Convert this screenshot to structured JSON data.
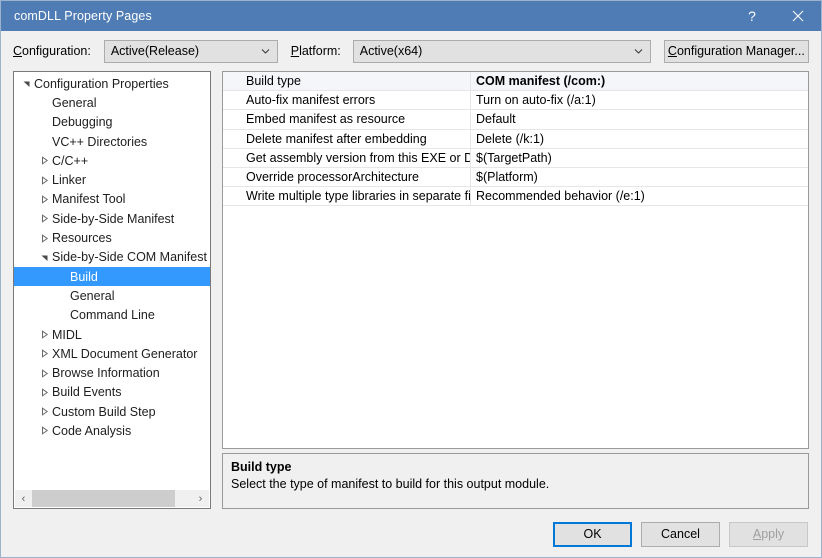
{
  "window": {
    "title": "comDLL Property Pages",
    "help_icon": "?",
    "close_icon": "close-icon",
    "titlebar_color": "#4f7cb5"
  },
  "config_bar": {
    "configuration_label": "Configuration:",
    "configuration_accel": "C",
    "configuration_value": "Active(Release)",
    "platform_label": "Platform:",
    "platform_accel": "P",
    "platform_value": "Active(x64)",
    "config_manager_label": "Configuration Manager...",
    "config_manager_accel": "C"
  },
  "tree": {
    "selected_color": "#3399ff",
    "nodes": [
      {
        "label": "Configuration Properties",
        "indent": 0,
        "expander": "expanded",
        "selected": false
      },
      {
        "label": "General",
        "indent": 1,
        "expander": "none",
        "selected": false
      },
      {
        "label": "Debugging",
        "indent": 1,
        "expander": "none",
        "selected": false
      },
      {
        "label": "VC++ Directories",
        "indent": 1,
        "expander": "none",
        "selected": false
      },
      {
        "label": "C/C++",
        "indent": 1,
        "expander": "collapsed",
        "selected": false
      },
      {
        "label": "Linker",
        "indent": 1,
        "expander": "collapsed",
        "selected": false
      },
      {
        "label": "Manifest Tool",
        "indent": 1,
        "expander": "collapsed",
        "selected": false
      },
      {
        "label": "Side-by-Side Manifest",
        "indent": 1,
        "expander": "collapsed",
        "selected": false
      },
      {
        "label": "Resources",
        "indent": 1,
        "expander": "collapsed",
        "selected": false
      },
      {
        "label": "Side-by-Side COM Manifest",
        "indent": 1,
        "expander": "expanded",
        "selected": false
      },
      {
        "label": "Build",
        "indent": 2,
        "expander": "none",
        "selected": true
      },
      {
        "label": "General",
        "indent": 2,
        "expander": "none",
        "selected": false
      },
      {
        "label": "Command Line",
        "indent": 2,
        "expander": "none",
        "selected": false
      },
      {
        "label": "MIDL",
        "indent": 1,
        "expander": "collapsed",
        "selected": false
      },
      {
        "label": "XML Document Generator",
        "indent": 1,
        "expander": "collapsed",
        "selected": false
      },
      {
        "label": "Browse Information",
        "indent": 1,
        "expander": "collapsed",
        "selected": false
      },
      {
        "label": "Build Events",
        "indent": 1,
        "expander": "collapsed",
        "selected": false
      },
      {
        "label": "Custom Build Step",
        "indent": 1,
        "expander": "collapsed",
        "selected": false
      },
      {
        "label": "Code Analysis",
        "indent": 1,
        "expander": "collapsed",
        "selected": false
      }
    ],
    "scrollbar": {
      "left_arrow": "‹",
      "right_arrow": "›"
    }
  },
  "property_grid": {
    "rows": [
      {
        "name": "Build type",
        "value": "COM manifest (/com:)"
      },
      {
        "name": "Auto-fix manifest errors",
        "value": "Turn on auto-fix (/a:1)"
      },
      {
        "name": "Embed manifest as resource",
        "value": "Default"
      },
      {
        "name": "Delete manifest after embedding",
        "value": "Delete (/k:1)"
      },
      {
        "name": "Get assembly version from this EXE or DLL",
        "value": "$(TargetPath)"
      },
      {
        "name": "Override processorArchitecture",
        "value": "$(Platform)"
      },
      {
        "name": "Write multiple type libraries in separate file",
        "value": "Recommended behavior (/e:1)"
      }
    ]
  },
  "description": {
    "title": "Build type",
    "text": "Select the type of manifest to build for this output module."
  },
  "footer": {
    "ok_label": "OK",
    "cancel_label": "Cancel",
    "apply_label": "Apply",
    "apply_accel": "A",
    "default_focus_color": "#0078d7"
  }
}
